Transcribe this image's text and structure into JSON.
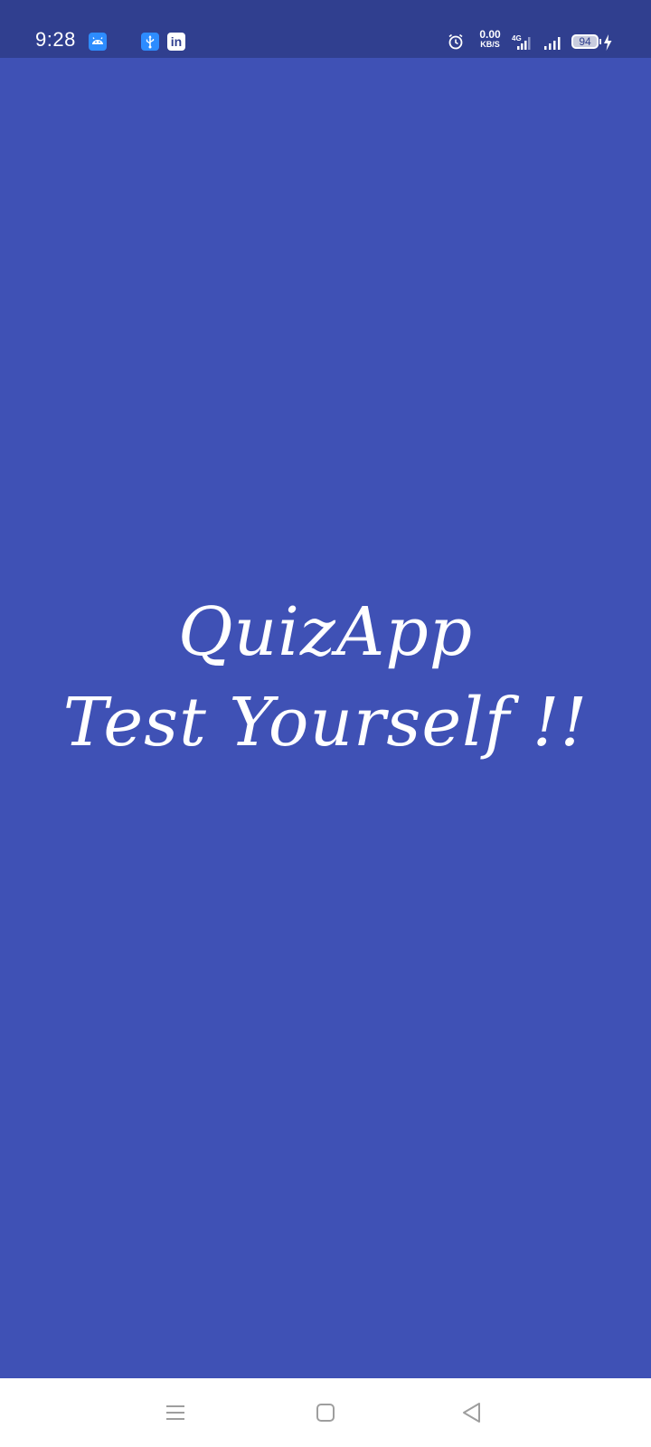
{
  "status_bar": {
    "time": "9:28",
    "notification_icons": [
      "android-icon",
      "usb-icon",
      "linkedin-icon"
    ],
    "linkedin_glyph": "in",
    "network_speed_value": "0.00",
    "network_speed_unit": "KB/S",
    "network_type": "4G",
    "battery_level": "94",
    "charging": true
  },
  "splash": {
    "title": "QuizApp",
    "subtitle": "Test Yourself !!",
    "background_color": "#3f51b5",
    "text_color": "#ffffff"
  },
  "nav_bar": {
    "buttons": [
      "menu-icon",
      "home-icon",
      "back-icon"
    ]
  }
}
